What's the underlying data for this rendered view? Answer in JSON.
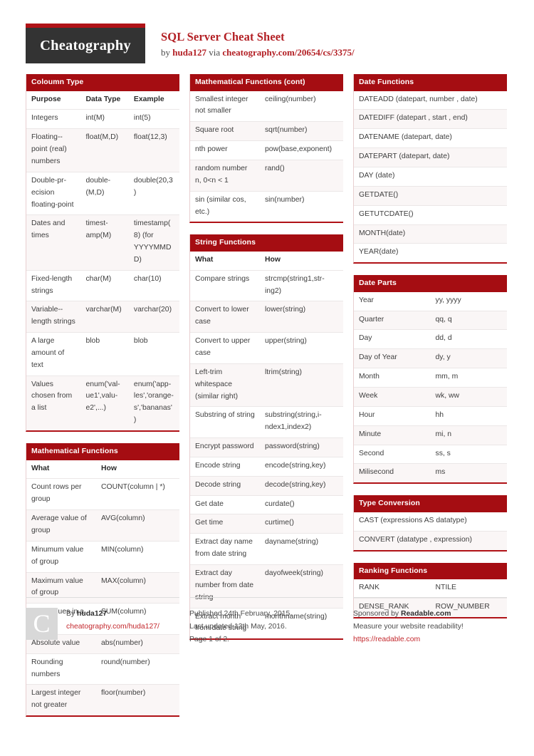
{
  "brand": {
    "logo_text": "Cheatography",
    "accent_red": "#a50d12",
    "title_red": "#b32025"
  },
  "header": {
    "title": "SQL Server Cheat Sheet",
    "by_prefix": "by ",
    "author": "huda127",
    "via": " via ",
    "source_url": "cheatography.com/20654/cs/3375/"
  },
  "tables": {
    "coloumn_type": {
      "title": "Coloumn Type",
      "headers": [
        "Purpose",
        "Data Type",
        "Example"
      ],
      "rows": [
        [
          "Integers",
          "int(M)",
          "int(5)"
        ],
        [
          "Floating--point (real) numbers",
          "float(M,D)",
          "float(12,3)"
        ],
        [
          "Double-pr­ecision floating-point",
          "double-(M,D)",
          "double(20,3)"
        ],
        [
          "Dates and times",
          "timest­amp(M)",
          "timestamp(8) (for YYYYMMDD)"
        ],
        [
          "Fixed-length strings",
          "char(M)",
          "char(10)"
        ],
        [
          "Variable--length strings",
          "varchar(M)",
          "varchar(20)"
        ],
        [
          "A large amount of text",
          "blob",
          "blob"
        ],
        [
          "Values chosen from a list",
          "enum('val­ue1',valu­e2',...)",
          "enum('app­les','orange­s','bananas')"
        ]
      ]
    },
    "math_functions": {
      "title": "Mathematical Functions",
      "headers": [
        "What",
        "How"
      ],
      "rows": [
        [
          "Count rows per group",
          "COUNT(column | *)"
        ],
        [
          "Average value of group",
          "AVG(column)"
        ],
        [
          "Minumum value of group",
          "MIN(column)"
        ],
        [
          "Maximum value of group",
          "MAX(column)"
        ],
        [
          "Sum values in a group",
          "SUM(column)"
        ],
        [
          "Absolute value",
          "abs(number)"
        ],
        [
          "Rounding numbers",
          "round(number)"
        ],
        [
          "Largest integer not greater",
          "floor(number)"
        ]
      ]
    },
    "math_functions_cont": {
      "title": "Mathematical Functions (cont)",
      "rows": [
        [
          "Smallest integer not smaller",
          "ceiling(number)"
        ],
        [
          "Square root",
          "sqrt(number)"
        ],
        [
          "nth power",
          "pow(base,exp­onent)"
        ],
        [
          "random number n, 0<n < 1",
          "rand()"
        ],
        [
          "sin (similar cos, etc.)",
          "sin(number)"
        ]
      ]
    },
    "string_functions": {
      "title": "String Functions",
      "headers": [
        "What",
        "How"
      ],
      "rows": [
        [
          "Compare strings",
          "strcmp(string1,str­ing2)"
        ],
        [
          "Convert to lower case",
          "lower(string)"
        ],
        [
          "Convert to upper case",
          "upper(string)"
        ],
        [
          "Left-trim whitespace (similar right)",
          "ltrim(string)"
        ],
        [
          "Substring of string",
          "substring(string,i­ndex1,index2)"
        ],
        [
          "Encrypt password",
          "password(string)"
        ],
        [
          "Encode string",
          "encode(string,key)"
        ],
        [
          "Decode string",
          "decode(string,key)"
        ],
        [
          "Get date",
          "curdate()"
        ],
        [
          "Get time",
          "curtime()"
        ],
        [
          "Extract day name from date string",
          "dayname(string)"
        ],
        [
          "Extract day number from date string",
          "dayofweek(string)"
        ],
        [
          "Extract month from date string",
          "monthname(string)"
        ]
      ]
    },
    "date_functions": {
      "title": "Date Functions",
      "rows": [
        [
          "DATEADD (datepart, number , date)"
        ],
        [
          "DATEDIFF (datepart , start , end)"
        ],
        [
          "DATENAME (datepart, date)"
        ],
        [
          "DATEPART (datepart, date)"
        ],
        [
          "DAY (date)"
        ],
        [
          "GETDATE()"
        ],
        [
          "GETUTCDATE()"
        ],
        [
          "MONTH(date)"
        ],
        [
          "YEAR(date)"
        ]
      ]
    },
    "date_parts": {
      "title": "Date Parts",
      "rows": [
        [
          "Year",
          "yy, yyyy"
        ],
        [
          "Quarter",
          "qq, q"
        ],
        [
          "Day",
          "dd, d"
        ],
        [
          "Day of Year",
          "dy, y"
        ],
        [
          "Month",
          "mm, m"
        ],
        [
          "Week",
          "wk, ww"
        ],
        [
          "Hour",
          "hh"
        ],
        [
          "Minute",
          "mi, n"
        ],
        [
          "Second",
          "ss, s"
        ],
        [
          "Milisecond",
          "ms"
        ]
      ]
    },
    "type_conversion": {
      "title": "Type Conversion",
      "rows": [
        [
          "CAST (expressions AS datatype)"
        ],
        [
          "CONVERT (datatype , expression)"
        ]
      ]
    },
    "ranking_functions": {
      "title": "Ranking Functions",
      "rows": [
        [
          "RANK",
          "NTILE"
        ],
        [
          "DENSE_RANK",
          "ROW_NUMBER"
        ]
      ]
    }
  },
  "footer": {
    "avatar_letter": "C",
    "by_label": "By ",
    "author": "huda127",
    "author_url": "cheatography.com/huda127/",
    "published": "Published 24th February, 2015.",
    "updated": "Last updated 13th May, 2016.",
    "page": "Page 1 of 2.",
    "sponsor_prefix": "Sponsored by ",
    "sponsor_name": "Readable.com",
    "sponsor_tagline": "Measure your website readability!",
    "sponsor_url": "https://readable.com"
  }
}
